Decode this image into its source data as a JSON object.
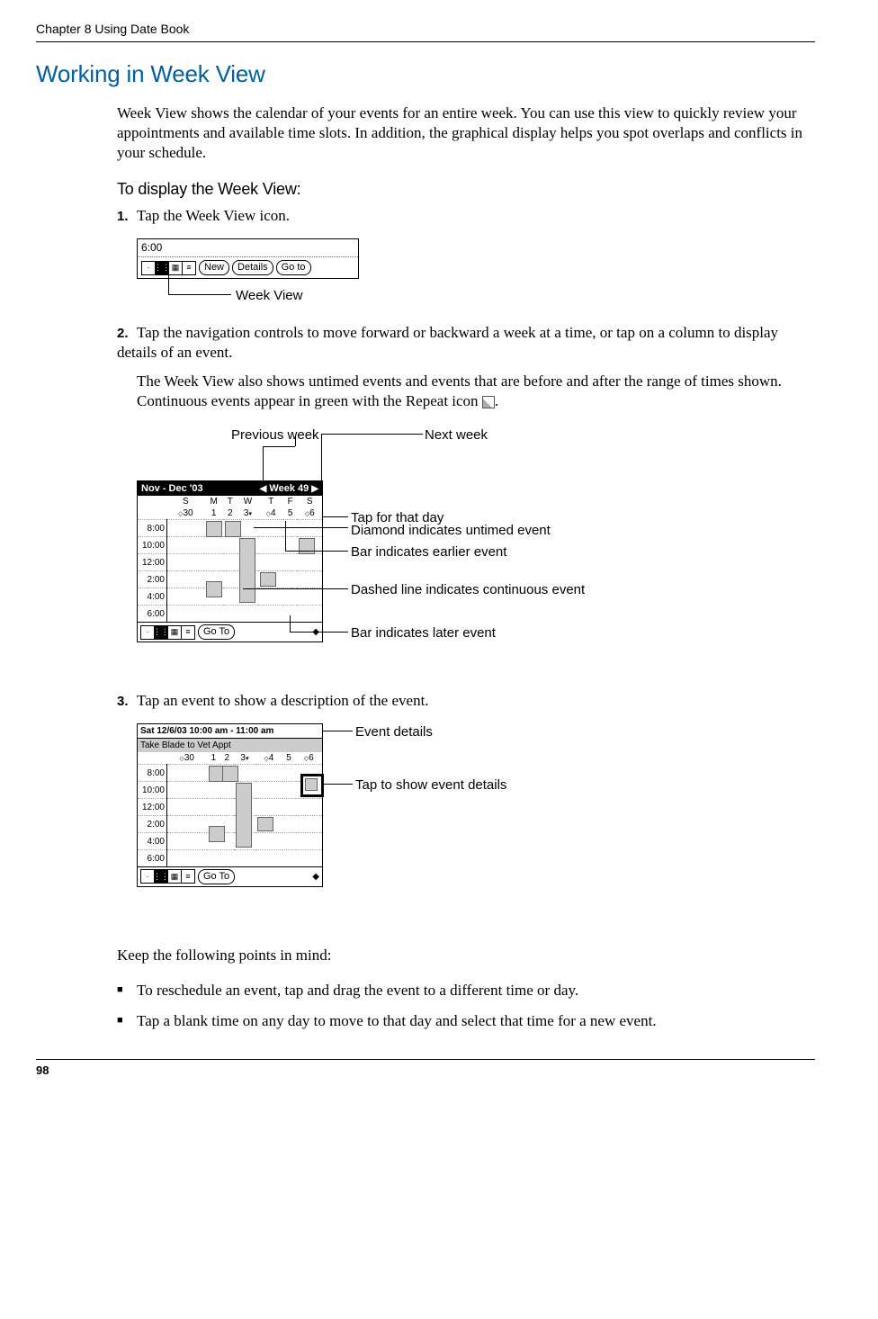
{
  "running_head": "Chapter 8    Using Date Book",
  "section_title": "Working in Week View",
  "intro": "Week View shows the calendar of your events for an entire week. You can use this view to quickly review your appointments and available time slots. In addition, the graphical display helps you spot overlaps and conflicts in your schedule.",
  "subhead": "To display the Week View:",
  "steps": {
    "s1": {
      "num": "1.",
      "text": "Tap the Week View icon."
    },
    "s2": {
      "num": "2.",
      "text": "Tap the navigation controls to move forward or backward a week at a time, or tap on a column to display details of an event."
    },
    "s2b": "The Week View also shows untimed events and events that are before and after the range of times shown. Continuous events appear in green with the Repeat icon ",
    "s2b_period": ".",
    "s3": {
      "num": "3.",
      "text": "Tap an event to show a description of the event."
    }
  },
  "fig1": {
    "time": "6:00",
    "btn_new": "New",
    "btn_details": "Details",
    "btn_goto": "Go to",
    "callout": "Week View"
  },
  "fig2": {
    "title_left": "Nov - Dec '03",
    "title_right": "Week 49",
    "days": [
      "S",
      "M",
      "T",
      "W",
      "T",
      "F",
      "S"
    ],
    "dates": [
      "30",
      "1",
      "2",
      "3",
      "4",
      "5",
      "6"
    ],
    "times": [
      "8:00",
      "10:00",
      "12:00",
      "2:00",
      "4:00",
      "6:00"
    ],
    "goto": "Go To",
    "c_prev": "Previous week",
    "c_next": "Next week",
    "c_tapday": "Tap for that day",
    "c_diamond": "Diamond indicates untimed event",
    "c_earlier": "Bar indicates earlier event",
    "c_dashed": "Dashed line indicates continuous event",
    "c_later": "Bar indicates later event"
  },
  "fig3": {
    "header": "Sat 12/6/03     10:00 am - 11:00 am",
    "sub": "Take Blade to Vet Appt",
    "dates": [
      "30",
      "1",
      "2",
      "3",
      "4",
      "5",
      "6"
    ],
    "times": [
      "8:00",
      "10:00",
      "12:00",
      "2:00",
      "4:00",
      "6:00"
    ],
    "goto": "Go To",
    "c_details": "Event details",
    "c_tap": "Tap to show event details"
  },
  "outro": "Keep the following points in mind:",
  "bullets": {
    "b1": "To reschedule an event, tap and drag the event to a different time or day.",
    "b2": "Tap a blank time on any day to move to that day and select that time for a new event."
  },
  "page_num": "98"
}
